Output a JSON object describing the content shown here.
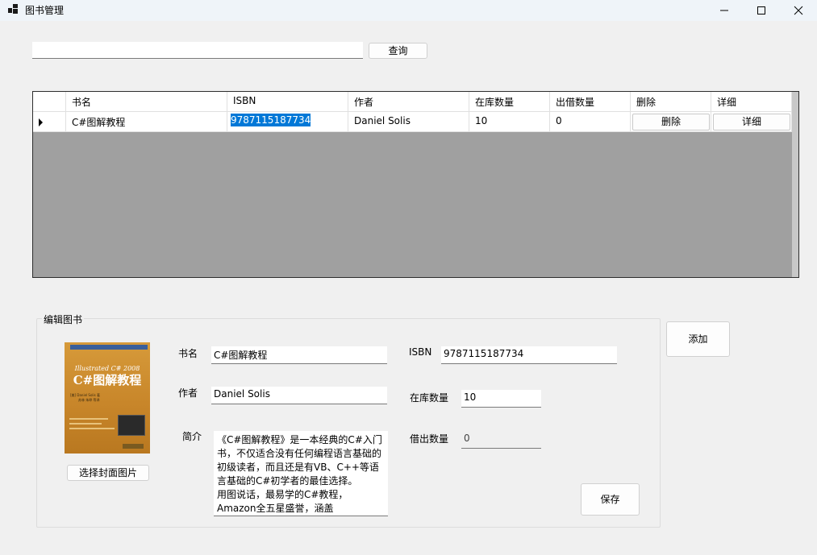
{
  "window": {
    "title": "图书管理",
    "controls": [
      "minimize-icon",
      "maximize-icon",
      "close-icon"
    ]
  },
  "search": {
    "value": "",
    "button_label": "查询"
  },
  "grid": {
    "columns": [
      "书名",
      "ISBN",
      "作者",
      "在库数量",
      "出借数量",
      "删除",
      "详细"
    ],
    "rows": [
      {
        "title": "C#图解教程",
        "isbn": "9787115187734",
        "author": "Daniel Solis",
        "in_stock": "10",
        "lent": "0",
        "delete_label": "删除",
        "detail_label": "详细"
      }
    ],
    "colors": {
      "background": "#a0a0a0",
      "selection": "#0078d7"
    }
  },
  "editor": {
    "group_title": "编辑图书",
    "choose_cover_label": "选择封面图片",
    "title_label": "书名",
    "title_value": "C#图解教程",
    "author_label": "作者",
    "author_value": "Daniel Solis",
    "intro_label": "简介",
    "intro_value": "《C#图解教程》是一本经典的C#入门书，不仅适合没有任何编程语言基础的初级读者，而且还是有VB、C++等语言基础的C#初学者的最佳选择。\n用图说话，最易学的C#教程，Amazon全五星盛誉，涵盖",
    "isbn_label": "ISBN",
    "isbn_value": "9787115187734",
    "stock_label": "在库数量",
    "stock_value": "10",
    "lent_label": "借出数量",
    "lent_value": "0",
    "save_label": "保存",
    "cover": {
      "subtitle": "Illustrated C# 2008",
      "title": "C#图解教程",
      "author_line": "[美] Daniel Solis 著",
      "translator_line": "苏林 朱晔 等译"
    }
  },
  "add_label": "添加"
}
